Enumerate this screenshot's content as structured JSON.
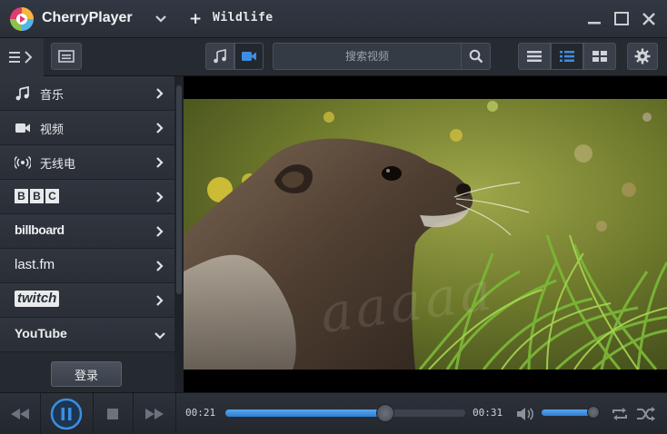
{
  "app": {
    "title": "CherryPlayer"
  },
  "tab": {
    "plus": "+",
    "title": "Wildlife"
  },
  "search": {
    "placeholder": "搜索视频"
  },
  "sidebar": {
    "items": [
      {
        "label": "音乐",
        "icon": "music-note-icon"
      },
      {
        "label": "视频",
        "icon": "video-camera-icon"
      },
      {
        "label": "无线电",
        "icon": "radio-icon"
      },
      {
        "label": "BBC",
        "icon": "bbc-logo"
      },
      {
        "label": "billboard",
        "icon": "billboard-logo"
      },
      {
        "label": "last.fm",
        "icon": "lastfm-logo"
      },
      {
        "label": "twitch",
        "icon": "twitch-logo"
      },
      {
        "label": "YouTube",
        "icon": "youtube-logo"
      }
    ],
    "login_label": "登录"
  },
  "player": {
    "elapsed": "00:21",
    "remaining": "00:31",
    "progress_fraction": 0.667,
    "volume_fraction": 0.95
  },
  "colors": {
    "accent": "#3b8ee4",
    "background": "#1b1f25",
    "panel": "#2a2f37"
  }
}
